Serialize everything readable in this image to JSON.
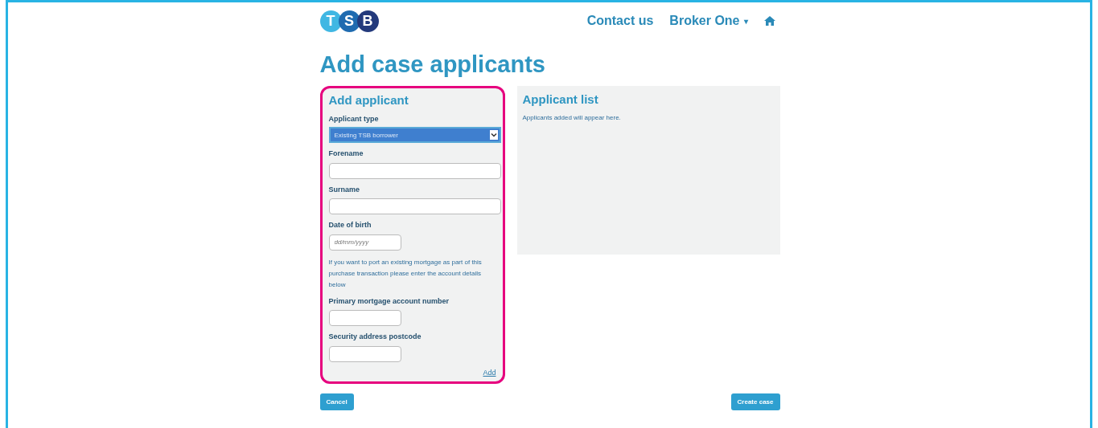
{
  "logo": {
    "letters": [
      "T",
      "S",
      "B"
    ]
  },
  "nav": {
    "links": [
      "Contact us",
      "Broker One"
    ],
    "dropdown_caret": "▾",
    "home_icon": true
  },
  "title": "Add case applicants",
  "add_panel": {
    "title": "Add applicant",
    "highlighted": true,
    "fields": [
      {
        "kind": "select",
        "label": "Applicant type",
        "value": "Existing TSB borrower"
      },
      {
        "kind": "text",
        "label": "Forename",
        "wide": true
      },
      {
        "kind": "text",
        "label": "Surname",
        "wide": true
      },
      {
        "kind": "text",
        "label": "Date of birth",
        "placeholder": "dd/mm/yyyy",
        "wide": false
      },
      {
        "kind": "note",
        "text": "If you want to port an existing mortgage as part of this purchase transaction please enter the account details below"
      },
      {
        "kind": "text",
        "label": "Primary mortgage account number",
        "wide": false
      },
      {
        "kind": "text",
        "label": "Security address postcode",
        "wide": false
      }
    ],
    "add_link": "Add"
  },
  "list_panel": {
    "title": "Applicant list",
    "message": "Applicants added will appear here."
  },
  "buttons": {
    "cancel": "Cancel",
    "create": "Create case"
  }
}
